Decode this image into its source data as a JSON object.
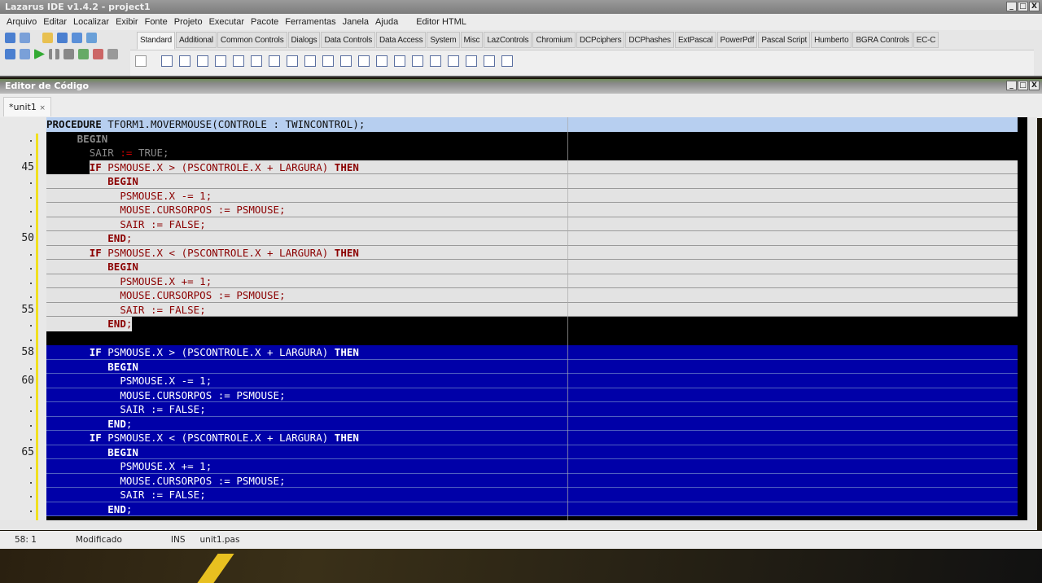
{
  "window": {
    "title": "Lazarus IDE v1.4.2 - project1"
  },
  "menu": [
    "Arquivo",
    "Editar",
    "Localizar",
    "Exibir",
    "Fonte",
    "Projeto",
    "Executar",
    "Pacote",
    "Ferramentas",
    "Janela",
    "Ajuda",
    "Editor HTML"
  ],
  "palette_tabs": [
    "Standard",
    "Additional",
    "Common Controls",
    "Dialogs",
    "Data Controls",
    "Data Access",
    "System",
    "Misc",
    "LazControls",
    "Chromium",
    "DCPciphers",
    "DCPhashes",
    "ExtPascal",
    "PowerPdf",
    "Pascal Script",
    "Humberto",
    "BGRA Controls",
    "EC-C"
  ],
  "palette_active": "Standard",
  "editor": {
    "title": "Editor de Código",
    "tab": "*unit1",
    "tab_close": "×"
  },
  "code_lines": [
    {
      "n": "",
      "t": "PROCEDURE TFORM1.MOVERMOUSE(CONTROLE : TWINCONTROL);",
      "s": "head"
    },
    {
      "n": ".",
      "t": "     BEGIN",
      "s": "dark"
    },
    {
      "n": ".",
      "t": "       SAIR := TRUE;",
      "s": "dark"
    },
    {
      "n": "45",
      "t": "       IF PSMOUSE.X > (PSCONTROLE.X + LARGURA) THEN",
      "s": "gray-from"
    },
    {
      "n": ".",
      "t": "          BEGIN",
      "s": "gray"
    },
    {
      "n": ".",
      "t": "            PSMOUSE.X -= 1;",
      "s": "gray"
    },
    {
      "n": ".",
      "t": "            MOUSE.CURSORPOS := PSMOUSE;",
      "s": "gray"
    },
    {
      "n": ".",
      "t": "            SAIR := FALSE;",
      "s": "gray"
    },
    {
      "n": "50",
      "t": "          END;",
      "s": "gray"
    },
    {
      "n": ".",
      "t": "       IF PSMOUSE.X < (PSCONTROLE.X + LARGURA) THEN",
      "s": "gray"
    },
    {
      "n": ".",
      "t": "          BEGIN",
      "s": "gray"
    },
    {
      "n": ".",
      "t": "            PSMOUSE.X += 1;",
      "s": "gray"
    },
    {
      "n": ".",
      "t": "            MOUSE.CURSORPOS := PSMOUSE;",
      "s": "gray"
    },
    {
      "n": "55",
      "t": "            SAIR := FALSE;",
      "s": "gray"
    },
    {
      "n": ".",
      "t": "          END;",
      "s": "gray-to"
    },
    {
      "n": ".",
      "t": "",
      "s": "dark"
    },
    {
      "n": "58",
      "t": "       IF PSMOUSE.X > (PSCONTROLE.X + LARGURA) THEN",
      "s": "blue"
    },
    {
      "n": ".",
      "t": "          BEGIN",
      "s": "blue"
    },
    {
      "n": "60",
      "t": "            PSMOUSE.X -= 1;",
      "s": "blue"
    },
    {
      "n": ".",
      "t": "            MOUSE.CURSORPOS := PSMOUSE;",
      "s": "blue"
    },
    {
      "n": ".",
      "t": "            SAIR := FALSE;",
      "s": "blue"
    },
    {
      "n": ".",
      "t": "          END;",
      "s": "blue"
    },
    {
      "n": ".",
      "t": "       IF PSMOUSE.X < (PSCONTROLE.X + LARGURA) THEN",
      "s": "blue"
    },
    {
      "n": "65",
      "t": "          BEGIN",
      "s": "blue"
    },
    {
      "n": ".",
      "t": "            PSMOUSE.X += 1;",
      "s": "blue"
    },
    {
      "n": ".",
      "t": "            MOUSE.CURSORPOS := PSMOUSE;",
      "s": "blue"
    },
    {
      "n": ".",
      "t": "            SAIR := FALSE;",
      "s": "blue"
    },
    {
      "n": ".",
      "t": "          END;",
      "s": "blue"
    }
  ],
  "keywords": [
    "PROCEDURE",
    "BEGIN",
    "END",
    "IF",
    "THEN"
  ],
  "status": {
    "position": "58: 1",
    "modified": "Modificado",
    "mode": "INS",
    "file": "unit1.pas"
  }
}
